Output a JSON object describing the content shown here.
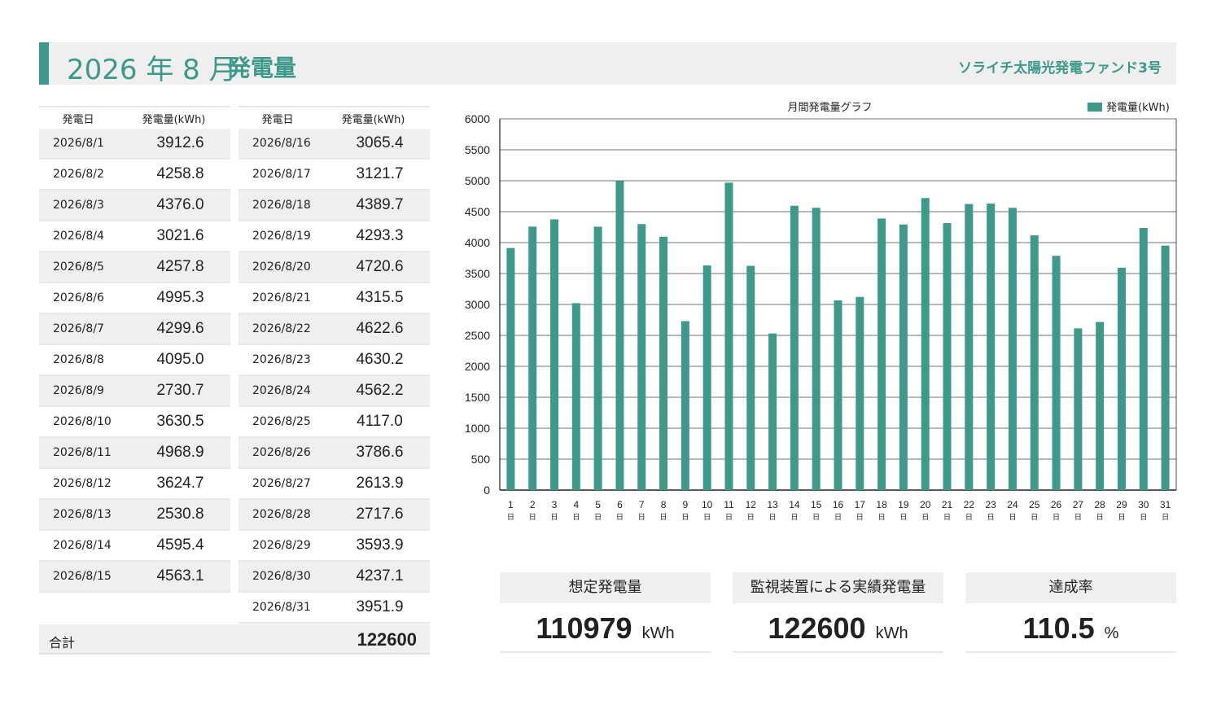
{
  "header": {
    "title_num": "2026 年 8 月",
    "title_text": "発電量",
    "fund_name": "ソライチ太陽光発電ファンド3号"
  },
  "table": {
    "col_date": "発電日",
    "col_value": "発電量(kWh)",
    "left_rows": [
      {
        "date": "2026/8/1",
        "value": "3912.6"
      },
      {
        "date": "2026/8/2",
        "value": "4258.8"
      },
      {
        "date": "2026/8/3",
        "value": "4376.0"
      },
      {
        "date": "2026/8/4",
        "value": "3021.6"
      },
      {
        "date": "2026/8/5",
        "value": "4257.8"
      },
      {
        "date": "2026/8/6",
        "value": "4995.3"
      },
      {
        "date": "2026/8/7",
        "value": "4299.6"
      },
      {
        "date": "2026/8/8",
        "value": "4095.0"
      },
      {
        "date": "2026/8/9",
        "value": "2730.7"
      },
      {
        "date": "2026/8/10",
        "value": "3630.5"
      },
      {
        "date": "2026/8/11",
        "value": "4968.9"
      },
      {
        "date": "2026/8/12",
        "value": "3624.7"
      },
      {
        "date": "2026/8/13",
        "value": "2530.8"
      },
      {
        "date": "2026/8/14",
        "value": "4595.4"
      },
      {
        "date": "2026/8/15",
        "value": "4563.1"
      }
    ],
    "right_rows": [
      {
        "date": "2026/8/16",
        "value": "3065.4"
      },
      {
        "date": "2026/8/17",
        "value": "3121.7"
      },
      {
        "date": "2026/8/18",
        "value": "4389.7"
      },
      {
        "date": "2026/8/19",
        "value": "4293.3"
      },
      {
        "date": "2026/8/20",
        "value": "4720.6"
      },
      {
        "date": "2026/8/21",
        "value": "4315.5"
      },
      {
        "date": "2026/8/22",
        "value": "4622.6"
      },
      {
        "date": "2026/8/23",
        "value": "4630.2"
      },
      {
        "date": "2026/8/24",
        "value": "4562.2"
      },
      {
        "date": "2026/8/25",
        "value": "4117.0"
      },
      {
        "date": "2026/8/26",
        "value": "3786.6"
      },
      {
        "date": "2026/8/27",
        "value": "2613.9"
      },
      {
        "date": "2026/8/28",
        "value": "2717.6"
      },
      {
        "date": "2026/8/29",
        "value": "3593.9"
      },
      {
        "date": "2026/8/30",
        "value": "4237.1"
      },
      {
        "date": "2026/8/31",
        "value": "3951.9"
      }
    ],
    "total_label": "合計",
    "total_value": "122600"
  },
  "summary": {
    "expected_label": "想定発電量",
    "expected_value": "110979",
    "expected_unit": "kWh",
    "actual_label": "監視装置による実績発電量",
    "actual_value": "122600",
    "actual_unit": "kWh",
    "rate_label": "達成率",
    "rate_value": "110.5",
    "rate_unit": "%"
  },
  "chart_data": {
    "type": "bar",
    "title": "月間発電量グラフ",
    "legend": "top-right",
    "bar_color": "#3d9a8b",
    "grid": true,
    "ylim": [
      0,
      6000
    ],
    "yticks": [
      0,
      500,
      1000,
      1500,
      2000,
      2500,
      3000,
      3500,
      4000,
      4500,
      5000,
      5500,
      6000
    ],
    "categories": [
      "1",
      "2",
      "3",
      "4",
      "5",
      "6",
      "7",
      "8",
      "9",
      "10",
      "11",
      "12",
      "13",
      "14",
      "15",
      "16",
      "17",
      "18",
      "19",
      "20",
      "21",
      "22",
      "23",
      "24",
      "25",
      "26",
      "27",
      "28",
      "29",
      "30",
      "31"
    ],
    "category_suffix": "日",
    "series": [
      {
        "name": "発電量(kWh)",
        "values": [
          3912.6,
          4258.8,
          4376.0,
          3021.6,
          4257.8,
          4995.3,
          4299.6,
          4095.0,
          2730.7,
          3630.5,
          4968.9,
          3624.7,
          2530.8,
          4595.4,
          4563.1,
          3065.4,
          3121.7,
          4389.7,
          4293.3,
          4720.6,
          4315.5,
          4622.6,
          4630.2,
          4562.2,
          4117.0,
          3786.6,
          2613.9,
          2717.6,
          3593.9,
          4237.1,
          3951.9
        ]
      }
    ]
  }
}
